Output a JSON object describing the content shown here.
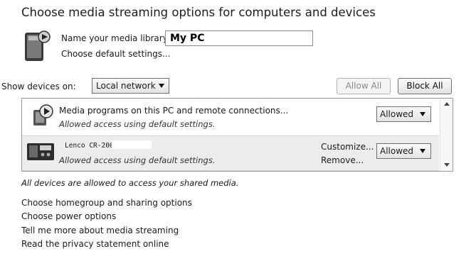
{
  "title": "Choose media streaming options for computers and devices",
  "library": {
    "name_label": "Name your media library:",
    "name_value": "My PC",
    "default_settings_link": "Choose default settings...",
    "icon": "media-library-icon"
  },
  "filter": {
    "label": "Show devices on:",
    "selected": "Local network"
  },
  "buttons": {
    "allow_all": "Allow All",
    "block_all": "Block All"
  },
  "devices": [
    {
      "icon": "media-player-icon",
      "name": "Media programs on this PC and remote connections...",
      "status": "Allowed access using default settings.",
      "state": "Allowed"
    },
    {
      "icon": "radio-device-icon",
      "name": "Lenco CR-2003",
      "status": "Allowed access using default settings.",
      "customize_link": "Customize...",
      "remove_link": "Remove...",
      "state": "Allowed"
    }
  ],
  "notice": "All devices are allowed to access your shared media.",
  "links": [
    "Choose homegroup and sharing options",
    "Choose power options",
    "Tell me more about media streaming",
    "Read the privacy statement online"
  ]
}
